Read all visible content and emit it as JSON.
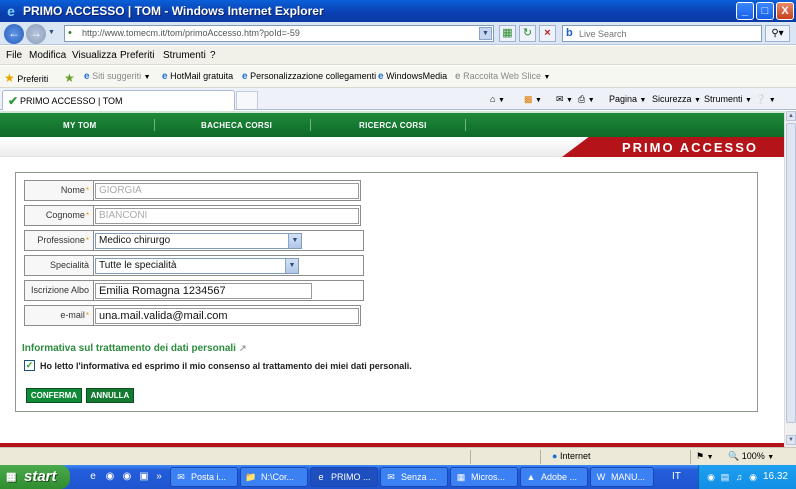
{
  "window": {
    "title": "PRIMO ACCESSO | TOM - Windows Internet Explorer",
    "minimize": "_",
    "maximize": "□",
    "close": "X"
  },
  "address": {
    "url": "http://www.tomecm.it/tom/primoAccesso.htm?poId=-59",
    "search_placeholder": "Live Search"
  },
  "menu": [
    "File",
    "Modifica",
    "Visualizza",
    "Preferiti",
    "Strumenti",
    "?"
  ],
  "favorites": {
    "label": "Preferiti",
    "items": [
      "Siti suggeriti",
      "HotMail gratuita",
      "Personalizzazione collegamenti",
      "WindowsMedia",
      "Raccolta Web Slice"
    ]
  },
  "tab": {
    "title": "PRIMO ACCESSO | TOM"
  },
  "commands": [
    "Pagina",
    "Sicurezza",
    "Strumenti"
  ],
  "site_nav": [
    "MY TOM",
    "BACHECA CORSI",
    "RICERCA CORSI"
  ],
  "page_heading": "PRIMO ACCESSO",
  "form": {
    "fields": [
      {
        "label": "Nome",
        "required": true,
        "value": "GIORGIA"
      },
      {
        "label": "Cognome",
        "required": true,
        "value": "BIANCONI"
      },
      {
        "label": "Professione",
        "required": true,
        "value": "Medico chirurgo"
      },
      {
        "label": "Specialità",
        "required": false,
        "value": "Tutte le specialità"
      },
      {
        "label": "Iscrizione Albo",
        "required": false,
        "value": "Emilia Romagna 1234567"
      },
      {
        "label": "e-mail",
        "required": true,
        "value": "una.mail.valida@mail.com"
      }
    ],
    "required_mark": "*",
    "privacy_link": "Informativa sul trattamento dei dati personali",
    "consent_text": "Ho letto l'informativa ed esprimo il mio consenso al trattamento dei miei dati personali.",
    "consent_checked": true,
    "confirm_label": "CONFERMA",
    "cancel_label": "ANNULLA"
  },
  "status": {
    "zone": "Internet",
    "zoom": "100%"
  },
  "taskbar": {
    "start": "start",
    "buttons": [
      "Posta i...",
      "N:\\Cor...",
      "PRIMO ...",
      "Senza ...",
      "Micros...",
      "Adobe ...",
      "MANU..."
    ],
    "active_index": 2,
    "lang": "IT",
    "clock": "16.32"
  },
  "colors": {
    "site_green": "#0e6a27",
    "site_red": "#b31319",
    "link_green": "#2c8c3e"
  }
}
